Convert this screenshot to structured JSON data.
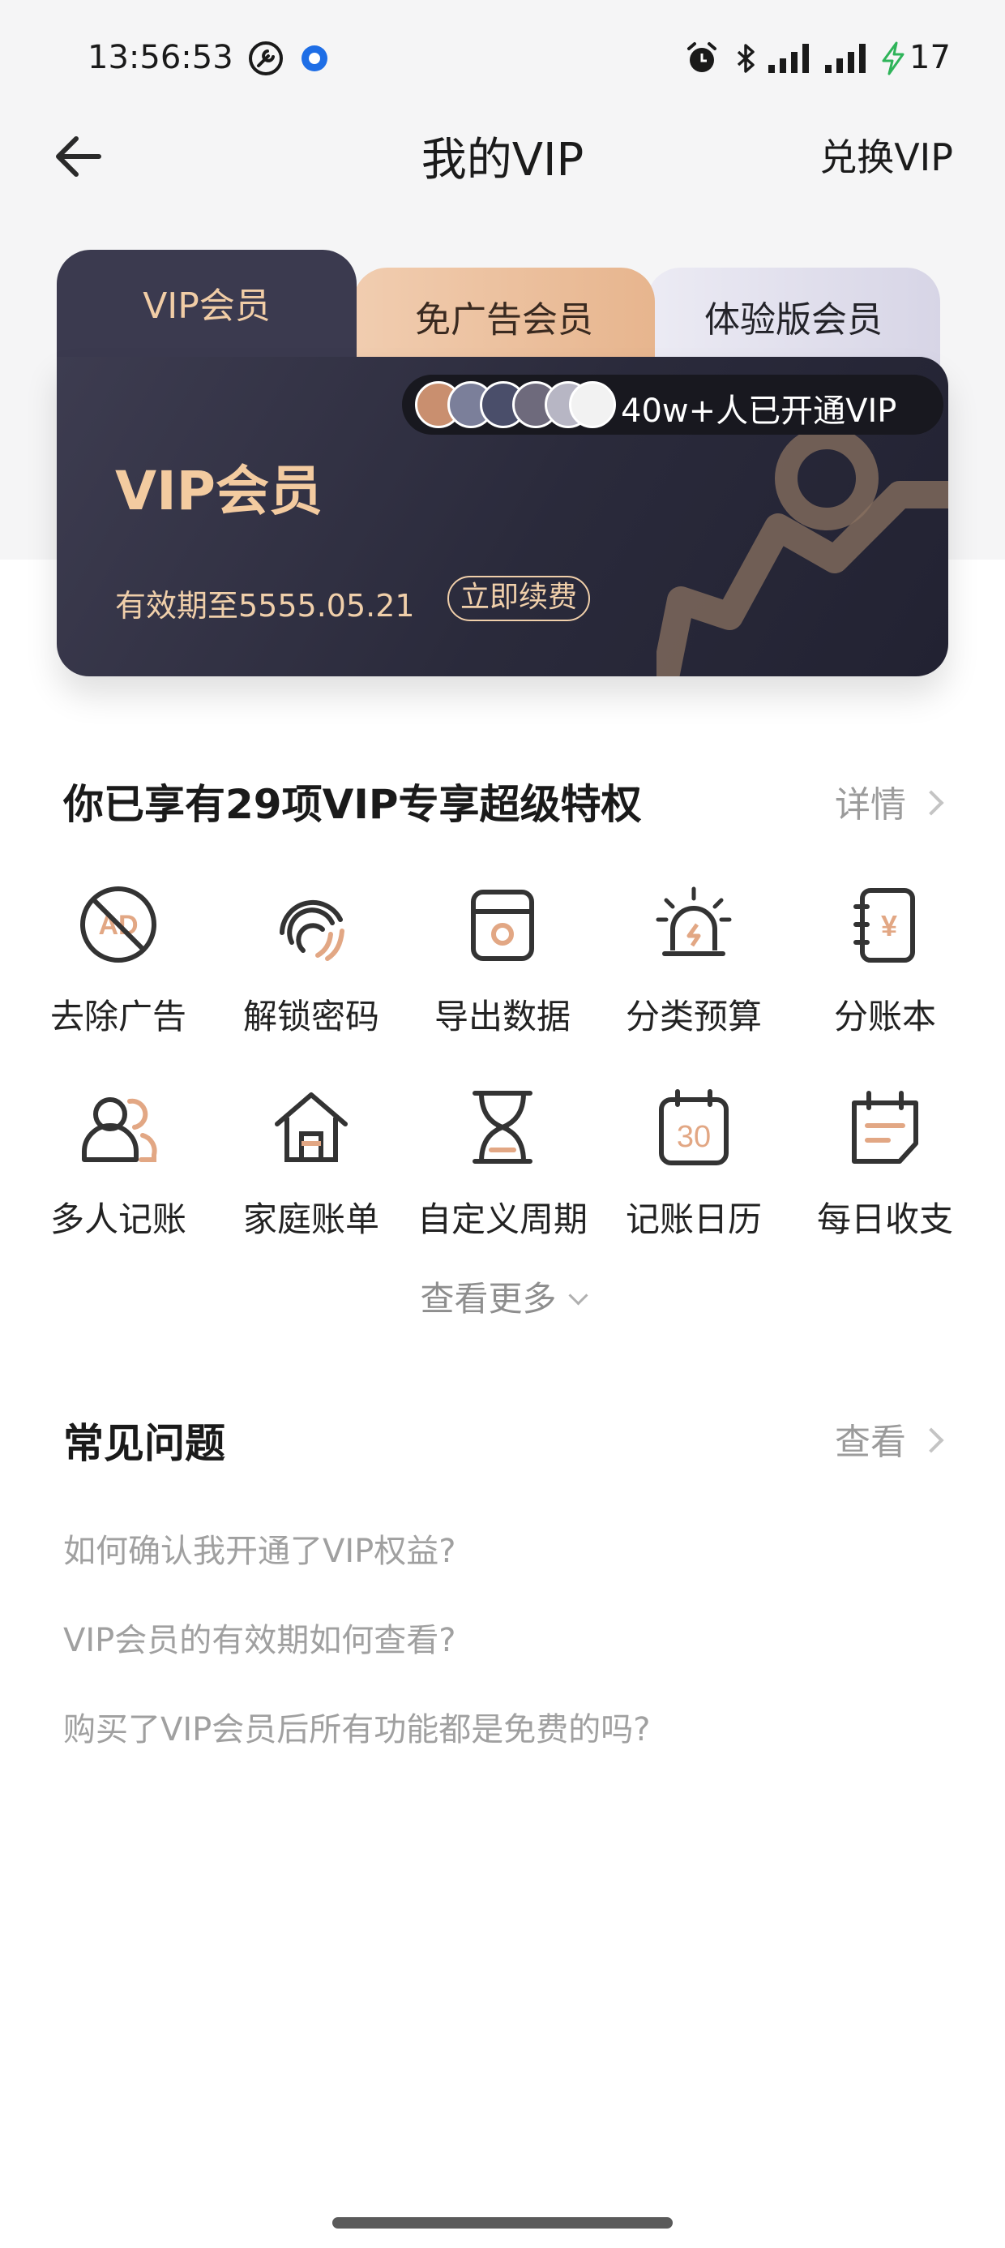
{
  "status_bar": {
    "time": "13:56:53",
    "battery": "17"
  },
  "nav": {
    "title": "我的VIP",
    "redeem": "兑换VIP"
  },
  "tabs": [
    {
      "label": "VIP会员"
    },
    {
      "label": "免广告会员"
    },
    {
      "label": "体验版会员"
    }
  ],
  "card": {
    "members_badge": "40w+人已开通VIP",
    "title": "VIP会员",
    "expire": "有效期至5555.05.21",
    "renew": "立即续费"
  },
  "privileges": {
    "title": "你已享有29项VIP专享超级特权",
    "detail": "详情",
    "items": [
      {
        "label": "去除广告",
        "icon": "no-ad-icon"
      },
      {
        "label": "解锁密码",
        "icon": "fingerprint-icon"
      },
      {
        "label": "导出数据",
        "icon": "export-icon"
      },
      {
        "label": "分类预算",
        "icon": "alarm-light-icon"
      },
      {
        "label": "分账本",
        "icon": "ledger-book-icon"
      },
      {
        "label": "多人记账",
        "icon": "users-icon"
      },
      {
        "label": "家庭账单",
        "icon": "house-icon"
      },
      {
        "label": "自定义周期",
        "icon": "hourglass-icon"
      },
      {
        "label": "记账日历",
        "icon": "calendar-30-icon"
      },
      {
        "label": "每日收支",
        "icon": "daily-note-icon"
      }
    ],
    "more": "查看更多"
  },
  "faq": {
    "title": "常见问题",
    "view": "查看",
    "items": [
      "如何确认我开通了VIP权益?",
      "VIP会员的有效期如何查看?",
      "购买了VIP会员后所有功能都是免费的吗?"
    ]
  },
  "colors": {
    "card": "#2f2e40",
    "gold": "#f3cba0",
    "accent": "#e3ac84"
  }
}
